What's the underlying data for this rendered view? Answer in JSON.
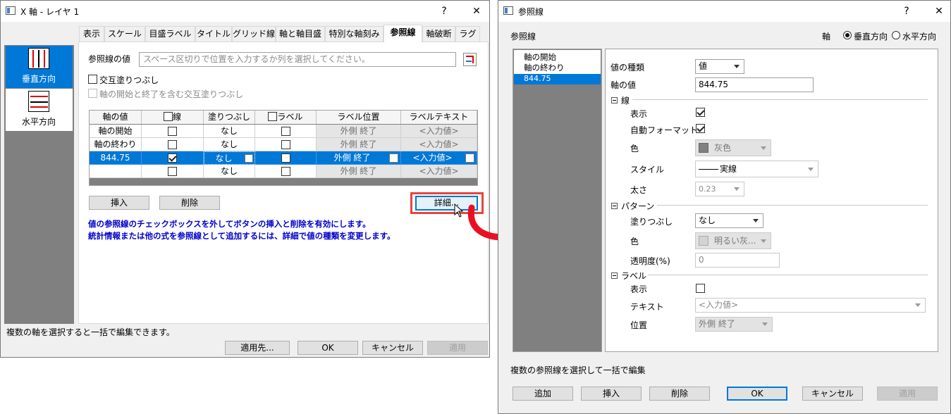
{
  "left_dialog": {
    "title": "X 軸 - レイヤ 1",
    "help": "?",
    "close": "✕",
    "side": {
      "vertical": "垂直方向",
      "horizontal": "水平方向"
    },
    "tabs": [
      "表示",
      "スケール",
      "目盛ラベル",
      "タイトル",
      "グリッド線",
      "軸と軸目盛",
      "特別な軸刻み",
      "参照線",
      "軸破断",
      "ラグ"
    ],
    "ref_value_label": "参照線の値",
    "ref_value_placeholder": "スペース区切りで位置を入力するか列を選択してください。",
    "alt_fill": "交互塗りつぶし",
    "alt_fill_ends": "軸の開始と終了を含む交互塗りつぶし",
    "table": {
      "headers": [
        "軸の値",
        "線",
        "塗りつぶし",
        "ラベル",
        "ラベル位置",
        "ラベルテキスト"
      ],
      "rows": [
        {
          "value": "軸の開始",
          "line": false,
          "fill": "なし",
          "label": false,
          "pos": "外側 終了",
          "text": "<入力値>"
        },
        {
          "value": "軸の終わり",
          "line": false,
          "fill": "なし",
          "label": false,
          "pos": "外側 終了",
          "text": "<入力値>"
        },
        {
          "value": "844.75",
          "line": true,
          "fill": "なし",
          "label": false,
          "pos": "外側 終了",
          "text": "<入力値>"
        },
        {
          "value": "",
          "line": false,
          "fill": "なし",
          "label": false,
          "pos": "外側 終了",
          "text": "<入力値>"
        }
      ]
    },
    "insert_btn": "挿入",
    "delete_btn": "削除",
    "detail_btn": "詳細...",
    "note1": "値の参照線のチェックボックスを外してボタンの挿入と削除を有効にします。",
    "note2": "統計情報または他の式を参照線として追加するには、詳細で値の種類を変更します。",
    "status": "複数の軸を選択すると一括で編集できます。",
    "apply_to": "適用先...",
    "ok": "OK",
    "cancel": "キャンセル",
    "apply": "適用"
  },
  "right_dialog": {
    "title": "参照線",
    "help": "?",
    "close": "✕",
    "heading": "参照線",
    "axis_label": "軸",
    "radio_vertical": "垂直方向",
    "radio_horizontal": "水平方向",
    "list": [
      "軸の開始",
      "軸の終わり",
      "844.75"
    ],
    "value_type_label": "値の種類",
    "value_type": "値",
    "axis_value_label": "軸の値",
    "axis_value": "844.75",
    "sec_line": "線",
    "show": "表示",
    "auto_format": "自動フォーマット",
    "color_label": "色",
    "color_value": "灰色",
    "style_label": "スタイル",
    "style_value": "実線",
    "width_label": "太さ",
    "width_value": "0.23",
    "sec_pattern": "パターン",
    "fill_label": "塗りつぶし",
    "fill_value": "なし",
    "pattern_color_label": "色",
    "pattern_color_value": "明るい灰...",
    "transparency_label": "透明度(%)",
    "transparency_value": "0",
    "sec_label": "ラベル",
    "label_show": "表示",
    "text_label": "テキスト",
    "text_value": "<入力値>",
    "position_label": "位置",
    "position_value": "外側 終了",
    "status": "複数の参照線を選択して一括で編集",
    "add": "追加",
    "insert": "挿入",
    "delete": "削除",
    "ok": "OK",
    "cancel": "キャンセル",
    "apply": "適用"
  },
  "colors": {
    "accent": "#0078d7",
    "highlight_box": "#e8453c",
    "arrow": "#e81123",
    "sidebar": "#808080"
  }
}
